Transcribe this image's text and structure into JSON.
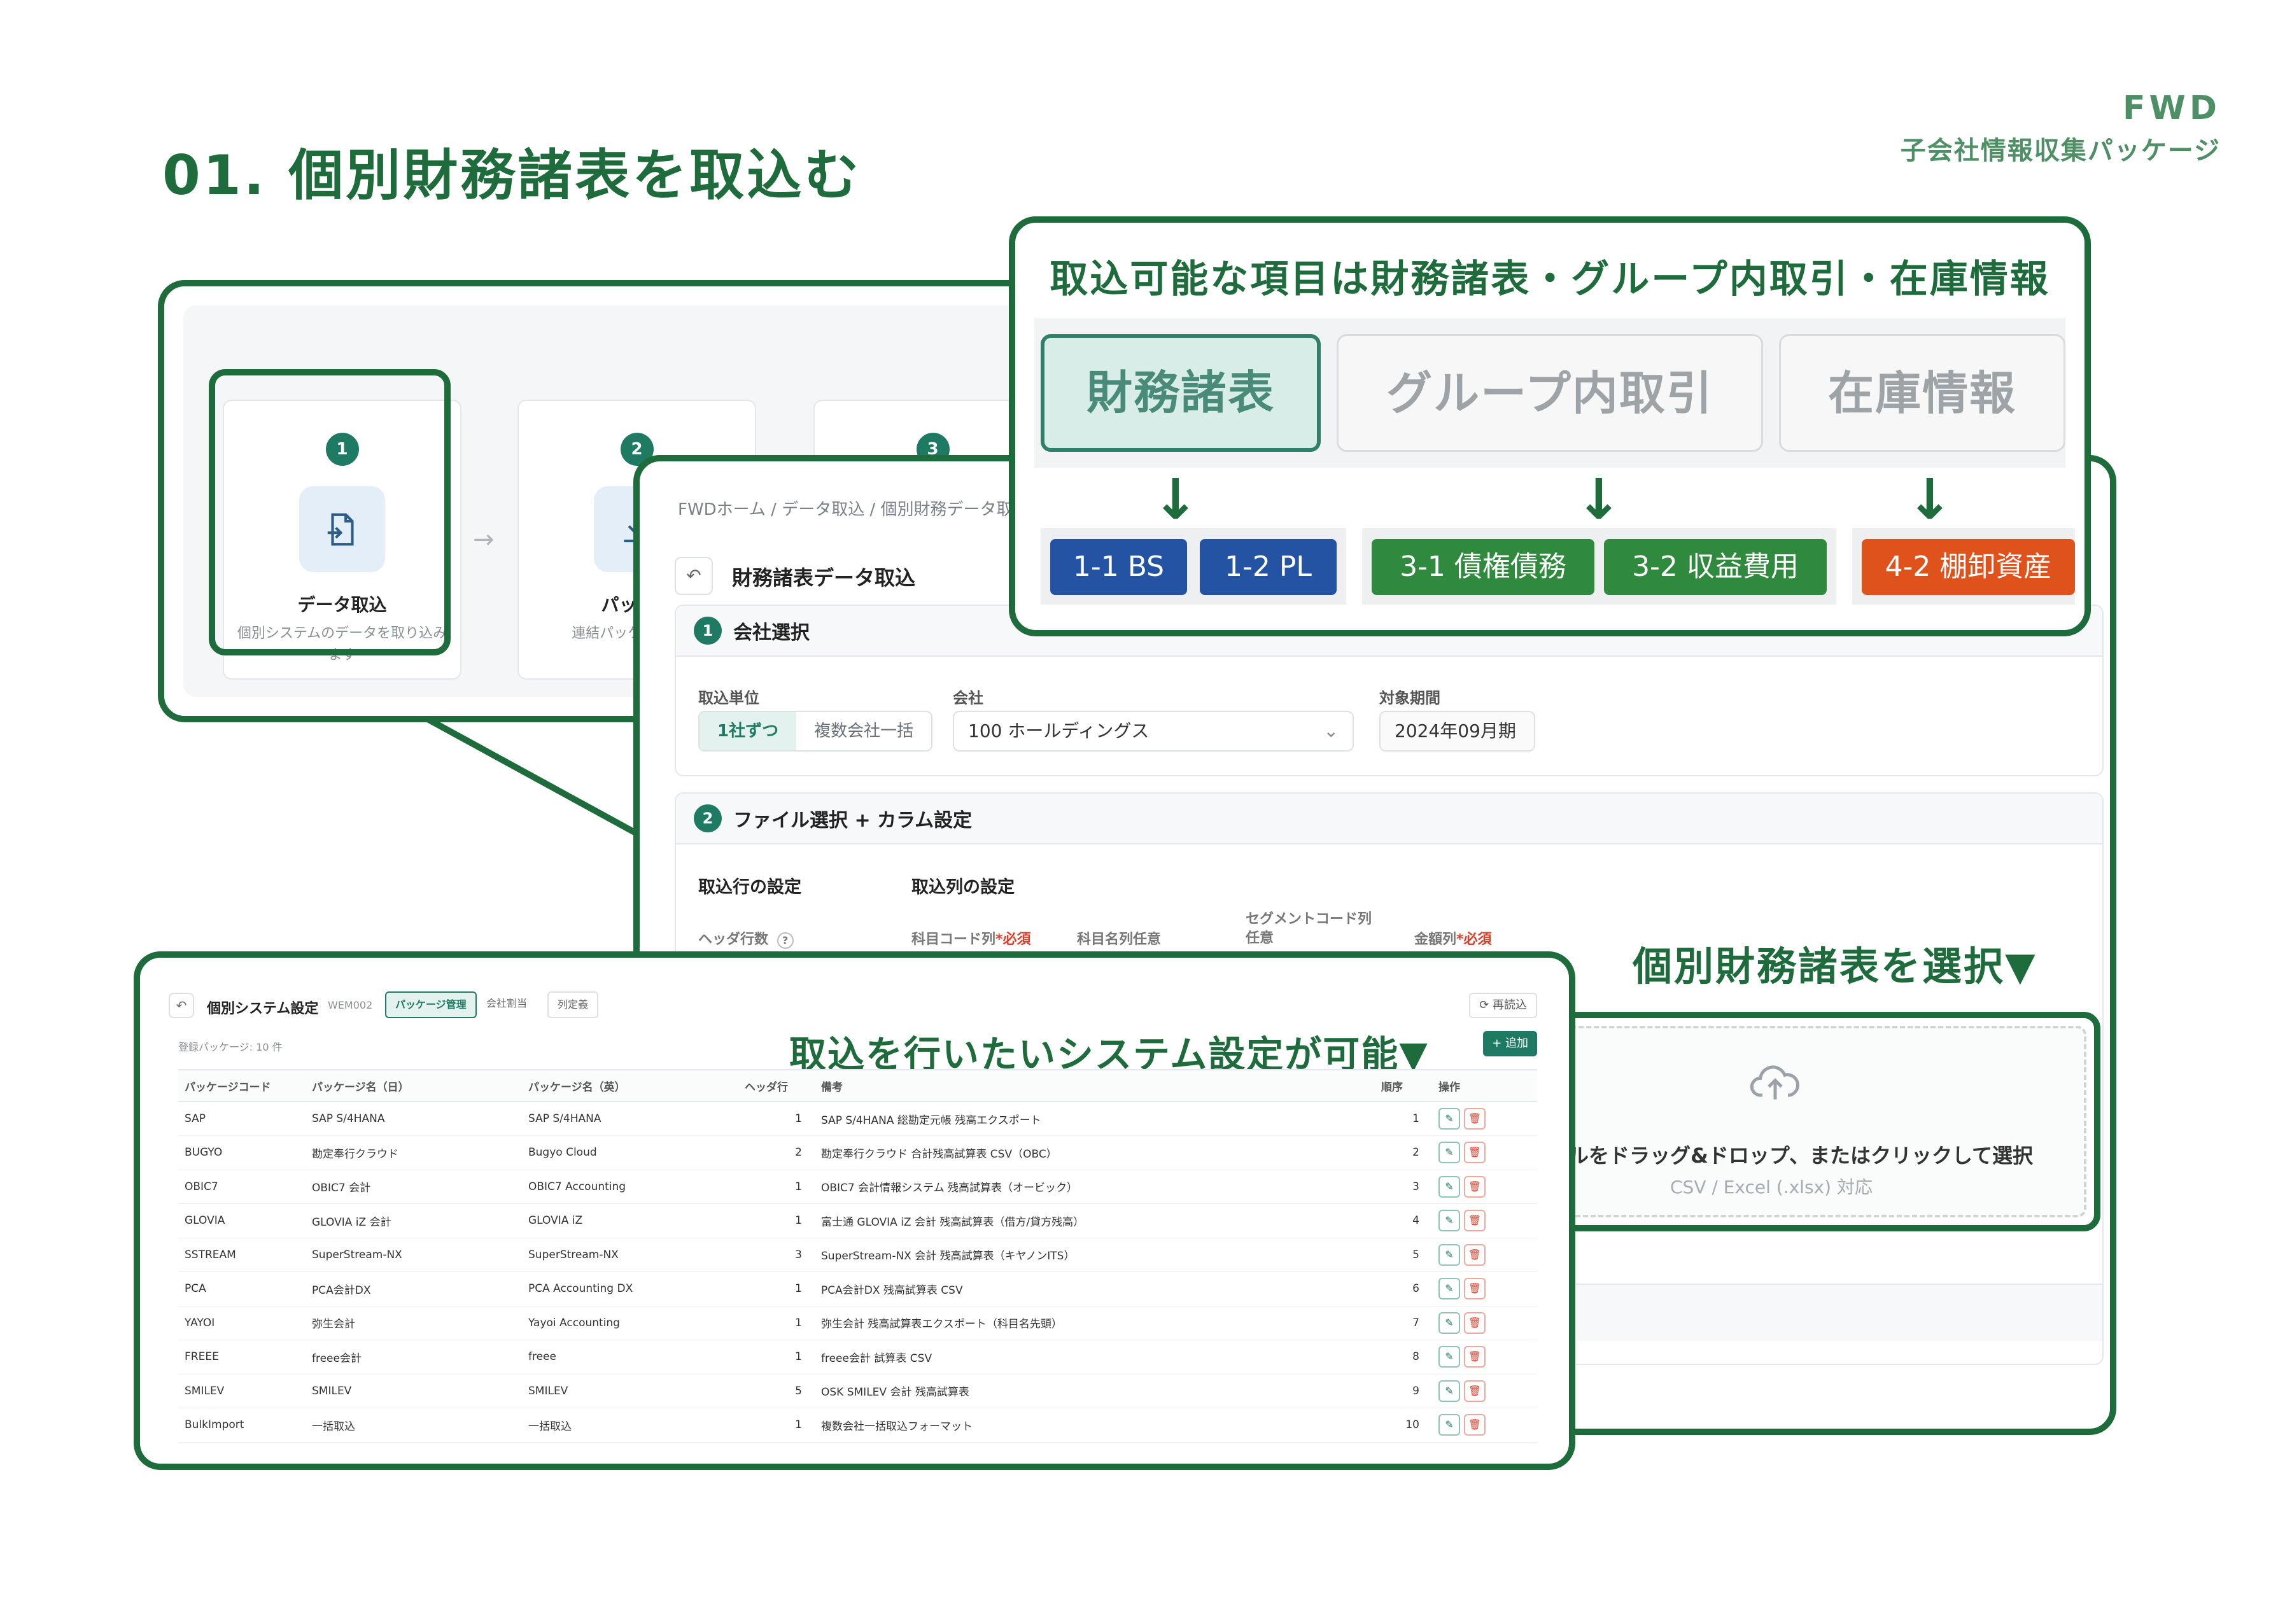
{
  "slide": {
    "title": "01. 個別財務諸表を取込む",
    "brand_name": "FWD",
    "brand_sub": "子会社情報収集パッケージ"
  },
  "steps": [
    {
      "num": "1",
      "title": "データ取込",
      "desc": "個別システムのデータを取り込みます",
      "icon": "file-import-icon"
    },
    {
      "num": "2",
      "title": "パッケー",
      "desc": "連結パッケージ ドし",
      "icon": "download-icon"
    },
    {
      "num": "3",
      "title": "",
      "desc": "",
      "icon": ""
    }
  ],
  "import_screen": {
    "breadcrumb": "FWDホーム / データ取込 / 個別財務データ取",
    "page_title": "財務諸表データ取込",
    "section1": {
      "num": "1",
      "title": "会社選択",
      "unit_label": "取込単位",
      "unit_options": [
        "1社ずつ",
        "複数会社一括"
      ],
      "company_label": "会社",
      "company_value": "100 ホールディングス",
      "period_label": "対象期間",
      "period_value": "2024年09月期"
    },
    "section2": {
      "num": "2",
      "title": "ファイル選択 + カラム設定",
      "row_setting": "取込行の設定",
      "col_setting": "取込列の設定",
      "header_rows_label": "ヘッダ行数",
      "help_icon": "?",
      "account_code_col": "科目コード列",
      "account_code_req": "*必須",
      "account_name_col": "科目名列任意",
      "segment_code_col_l1": "セグメントコード列",
      "segment_code_col_l2": "任意",
      "amount_col": "金額列",
      "amount_req": "*必須"
    }
  },
  "items_callout": {
    "title": "取込可能な項目は財務諸表・グループ内取引・在庫情報",
    "tabs": [
      "財務諸表",
      "グループ内取引",
      "在庫情報"
    ],
    "chips": [
      {
        "label": "1-1 BS",
        "color": "#2453a3"
      },
      {
        "label": "1-2 PL",
        "color": "#2453a3"
      },
      {
        "label": "3-1 債権債務",
        "color": "#2f8a3d"
      },
      {
        "label": "3-2 収益費用",
        "color": "#2f8a3d"
      },
      {
        "label": "4-2 棚卸資産",
        "color": "#e0521c"
      }
    ]
  },
  "select_callout": "個別財務諸表を選択▼",
  "upload": {
    "text": "ルをドラッグ&ドロップ、またはクリックして選択",
    "sub": "CSV / Excel (.xlsx) 対応"
  },
  "settings_screen": {
    "title": "個別システム設定",
    "code": "WEM002",
    "tabs": [
      "パッケージ管理",
      "会社割当",
      "列定義"
    ],
    "reload": "⟳ 再読込",
    "count": "登録パッケージ: 10 件",
    "add": "+ 追加",
    "callout": "取込を行いたいシステム設定が可能▼",
    "columns": [
      "パッケージコード",
      "パッケージ名（日）",
      "パッケージ名（英）",
      "ヘッダ行",
      "備考",
      "順序",
      "操作"
    ],
    "rows": [
      [
        "SAP",
        "SAP S/4HANA",
        "SAP S/4HANA",
        "1",
        "SAP S/4HANA 総勘定元帳 残高エクスポート",
        "1"
      ],
      [
        "BUGYO",
        "勘定奉行クラウド",
        "Bugyo Cloud",
        "2",
        "勘定奉行クラウド 合計残高試算表 CSV（OBC）",
        "2"
      ],
      [
        "OBIC7",
        "OBIC7 会計",
        "OBIC7 Accounting",
        "1",
        "OBIC7 会計情報システム 残高試算表（オービック）",
        "3"
      ],
      [
        "GLOVIA",
        "GLOVIA iZ 会計",
        "GLOVIA iZ",
        "1",
        "富士通 GLOVIA iZ 会計 残高試算表（借方/貸方残高）",
        "4"
      ],
      [
        "SSTREAM",
        "SuperStream-NX",
        "SuperStream-NX",
        "3",
        "SuperStream-NX 会計 残高試算表（キヤノンITS）",
        "5"
      ],
      [
        "PCA",
        "PCA会計DX",
        "PCA Accounting DX",
        "1",
        "PCA会計DX 残高試算表 CSV",
        "6"
      ],
      [
        "YAYOI",
        "弥生会計",
        "Yayoi Accounting",
        "1",
        "弥生会計 残高試算表エクスポート（科目名先頭）",
        "7"
      ],
      [
        "FREEE",
        "freee会計",
        "freee",
        "1",
        "freee会計 試算表 CSV",
        "8"
      ],
      [
        "SMILEV",
        "SMILEV",
        "SMILEV",
        "5",
        "OSK SMILEV 会計 残高試算表",
        "9"
      ],
      [
        "BulkImport",
        "一括取込",
        "一括取込",
        "1",
        "複数会社一括取込フォーマット",
        "10"
      ]
    ]
  }
}
